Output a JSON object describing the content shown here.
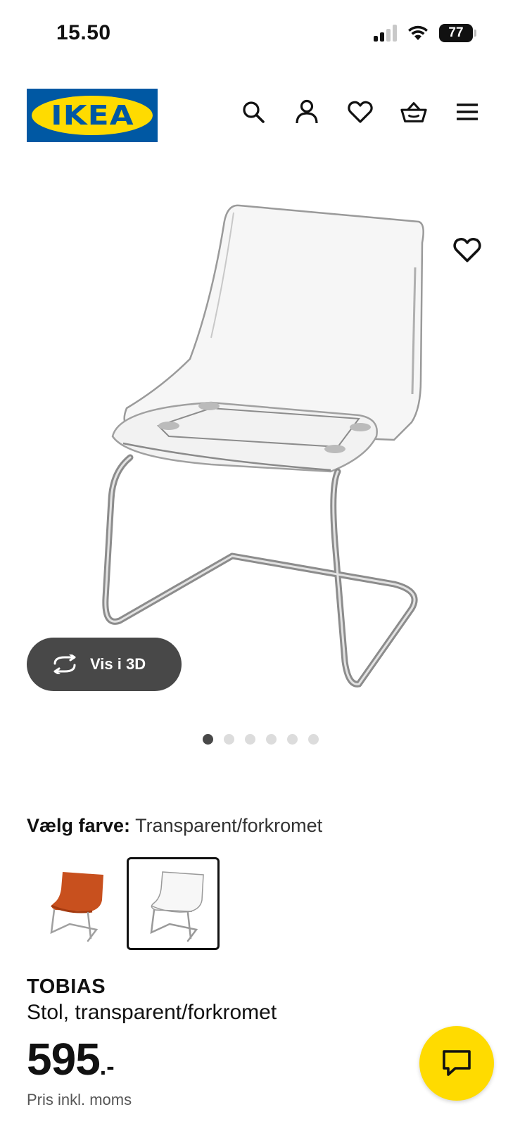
{
  "status_bar": {
    "time": "15.50",
    "battery": "77"
  },
  "header": {
    "logo_text": "IKEA",
    "icons": [
      "search-icon",
      "account-icon",
      "favorites-icon",
      "basket-icon",
      "menu-icon"
    ]
  },
  "gallery": {
    "view_3d_label": "Vis i 3D",
    "image_count": 6,
    "active_index": 0
  },
  "color_select": {
    "label": "Vælg farve:",
    "value": "Transparent/forkromet",
    "swatches": [
      "orange-chair",
      "transparent-chair"
    ],
    "selected_index": 1
  },
  "product": {
    "name": "TOBIAS",
    "description": "Stol, transparent/forkromet",
    "price": "595",
    "price_suffix": ".-",
    "price_note": "Pris inkl. moms"
  },
  "colors": {
    "ikea_blue": "#0058a3",
    "ikea_yellow": "#ffdb00",
    "dark_button": "#484848"
  }
}
